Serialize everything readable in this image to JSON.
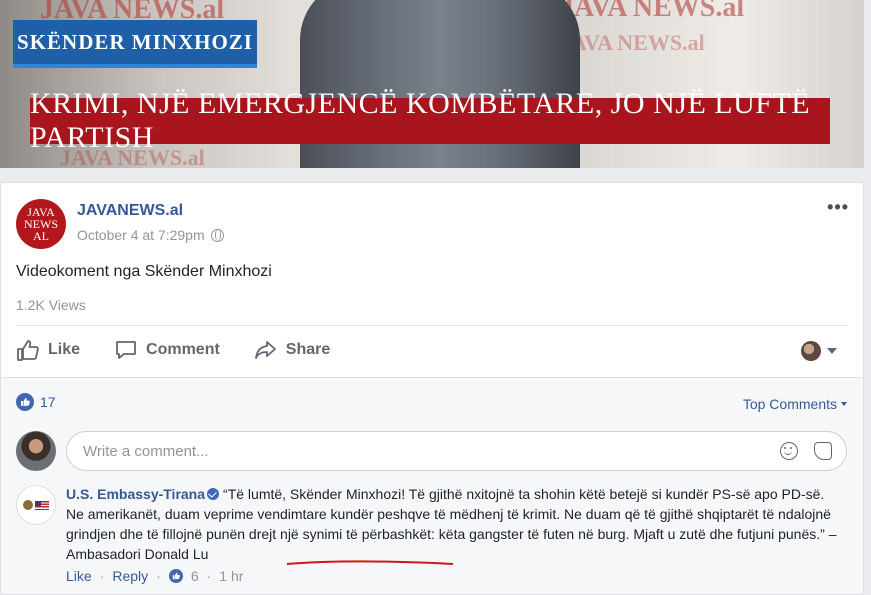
{
  "video": {
    "name_caption": "SKËNDER MINXHOZI",
    "headline": "KRIMI, NJË EMERGJENCË KOMBËTARE, JO NJË LUFTË PARTISH",
    "watermark": "JAVA NEWS.al",
    "accent": "#a8151d"
  },
  "post": {
    "avatar_lines": [
      "JAVA",
      "NEWS",
      "AL"
    ],
    "page_name": "JAVANEWS.al",
    "time": "October 4 at 7:29pm",
    "privacy_icon": "globe-icon",
    "text": "Videokoment nga Skënder Minxhozi",
    "views": "1.2K Views",
    "more_label": "•••",
    "actions": {
      "like": "Like",
      "comment": "Comment",
      "share": "Share"
    }
  },
  "comments": {
    "like_count": "17",
    "sort_label": "Top Comments",
    "input_placeholder": "Write a comment...",
    "items": [
      {
        "author": "U.S. Embassy-Tirana",
        "text_main": "“Të lumtë, Skënder Minxhozi! Të gjithë nxitojnë ta shohin këtë betejë si kundër PS-së apo PD-së. Ne amerikanët, duam veprime vendimtare kundër peshqve të mëdhenj të krimit. Ne duam që të gjithë shqiptarët të ndalojnë grindjen dhe të fillojnë punën drejt një synimi të përbashkët: këta gangster të futen në burg. Mjaft u zutë dhe futjuni punës.” – ",
        "text_attribution": "Ambasadori Donald Lu",
        "like_label": "Like",
        "reply_label": "Reply",
        "reaction_count": "6",
        "age": "1 hr"
      }
    ]
  },
  "colors": {
    "link": "#365899",
    "fb_blue": "#4267b2",
    "muted": "#90949c"
  }
}
